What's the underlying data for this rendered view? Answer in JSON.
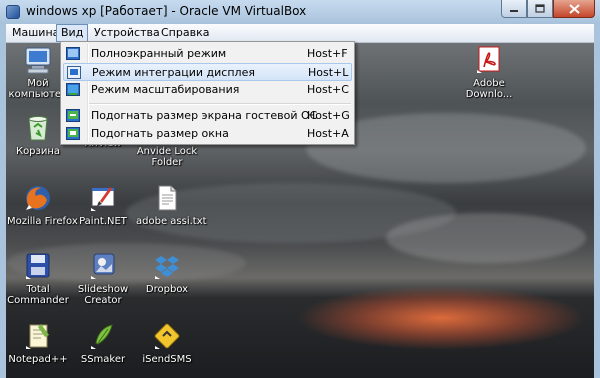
{
  "window": {
    "title": "windows xp [Работает] - Oracle VM VirtualBox"
  },
  "menubar": {
    "items": [
      {
        "label": "Машина"
      },
      {
        "label": "Вид"
      },
      {
        "label": "Устройства"
      },
      {
        "label": "Справка"
      }
    ],
    "active": "Вид"
  },
  "view_menu": {
    "items": [
      {
        "label": "Полноэкранный режим",
        "shortcut": "Host+F",
        "icon": "fullscreen-icon"
      },
      {
        "label": "Режим интеграции дисплея",
        "shortcut": "Host+L",
        "icon": "seamless-icon",
        "highlighted": true
      },
      {
        "label": "Режим масштабирования",
        "shortcut": "Host+C",
        "icon": "scale-icon"
      },
      {
        "label": "Подогнать размер экрана гостевой ОС",
        "shortcut": "Host+G",
        "icon": "adjust-guest-icon"
      },
      {
        "label": "Подогнать размер окна",
        "shortcut": "Host+A",
        "icon": "adjust-window-icon"
      }
    ]
  },
  "desktop": {
    "icons": [
      {
        "label": "Мой\nкомпьютер",
        "icon": "my-computer-icon"
      },
      {
        "label": "Корзина",
        "icon": "recycle-bin-icon"
      },
      {
        "label": "XnView",
        "icon": "xnview-icon"
      },
      {
        "label": "Anvide Lock\nFolder",
        "icon": "lock-folder-icon"
      },
      {
        "label": "Mozilla Firefox",
        "icon": "firefox-icon"
      },
      {
        "label": "Paint.NET",
        "icon": "paintnet-icon"
      },
      {
        "label": "adobe assi.txt",
        "icon": "text-file-icon"
      },
      {
        "label": "Total\nCommander",
        "icon": "total-commander-icon"
      },
      {
        "label": "Slideshow\nCreator",
        "icon": "slideshow-creator-icon"
      },
      {
        "label": "Dropbox",
        "icon": "dropbox-icon"
      },
      {
        "label": "Notepad++",
        "icon": "notepadpp-icon"
      },
      {
        "label": "SSmaker",
        "icon": "ssmaker-icon"
      },
      {
        "label": "iSendSMS",
        "icon": "isendsms-icon"
      },
      {
        "label": "Adobe\nDownlo...",
        "icon": "adobe-icon"
      }
    ]
  },
  "colors": {
    "titlebar": "#b8cfe6",
    "menu_highlight": "#d3e4f8",
    "close_button": "#c4462b"
  }
}
